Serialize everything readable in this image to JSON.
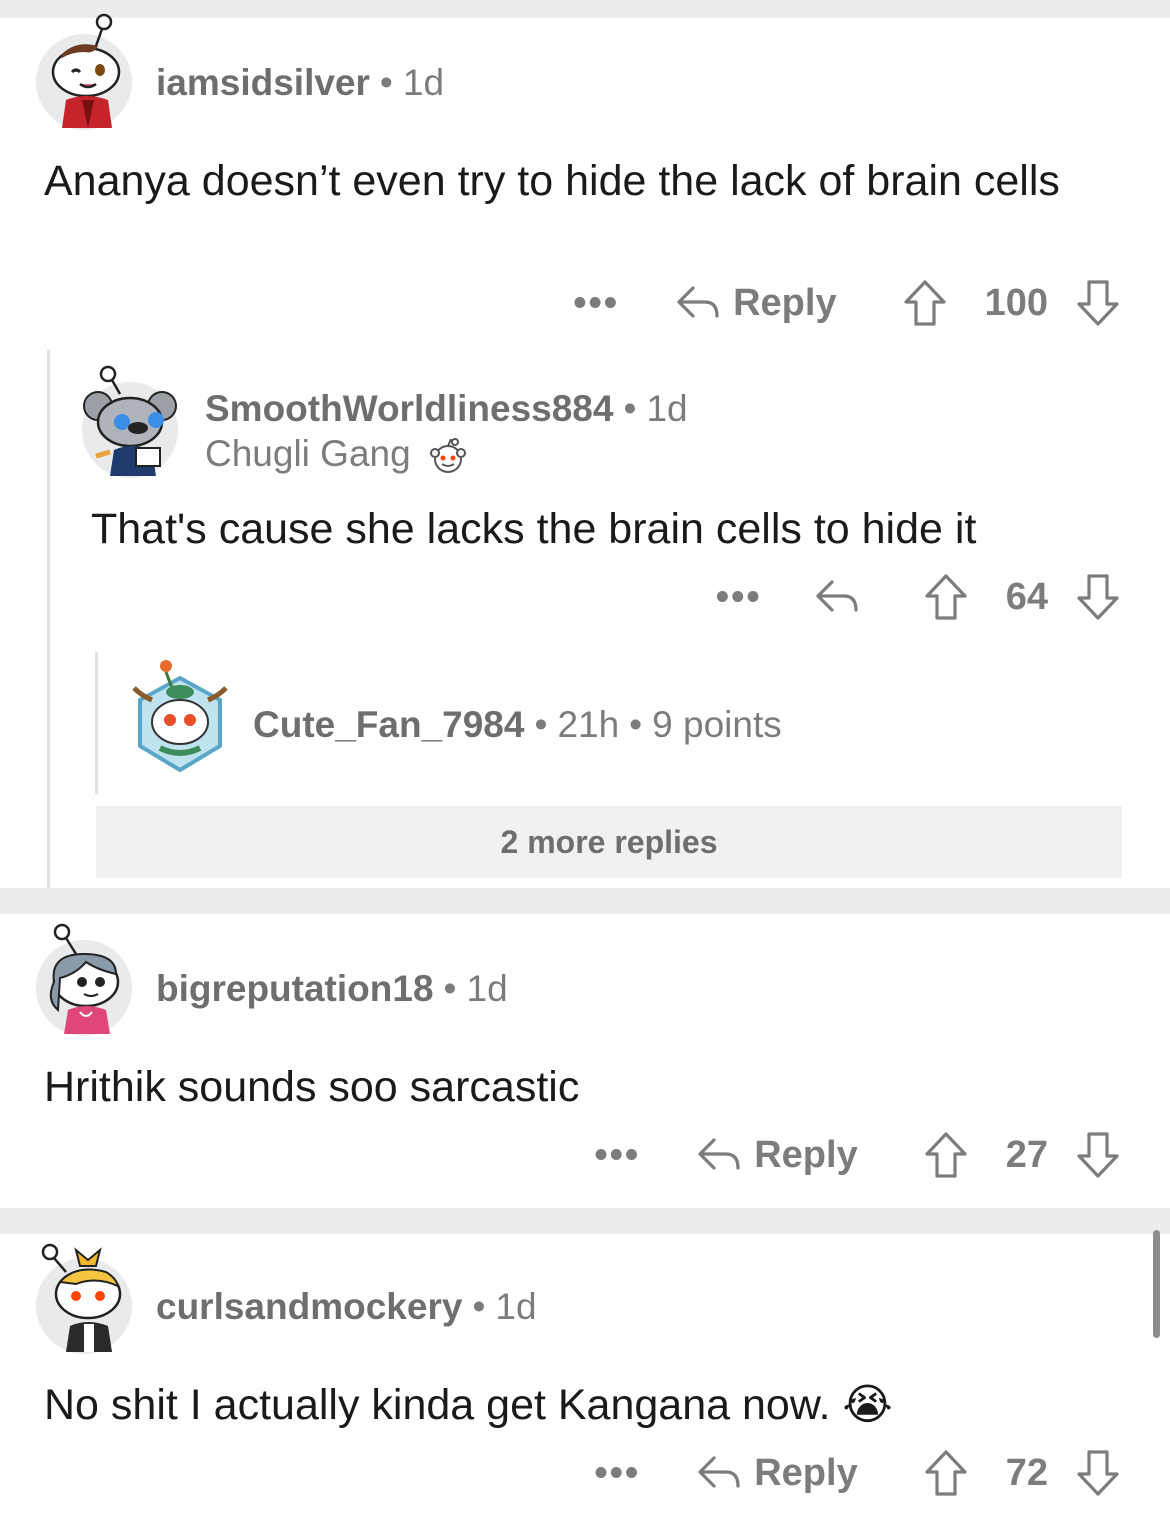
{
  "comments": [
    {
      "username": "iamsidsilver",
      "age": "1d",
      "body": "Ananya doesn’t even try to hide the lack of brain cells",
      "reply_label": "Reply",
      "score": "100"
    },
    {
      "username": "SmoothWorldliness884",
      "age": "1d",
      "flair": "Chugli Gang",
      "body": "That's cause she lacks the brain cells to hide it",
      "score": "64"
    },
    {
      "username": "Cute_Fan_7984",
      "age": "21h",
      "points": "9 points"
    },
    {
      "username": "bigreputation18",
      "age": "1d",
      "body": "Hrithik sounds soo sarcastic",
      "reply_label": "Reply",
      "score": "27"
    },
    {
      "username": "curlsandmockery",
      "age": "1d",
      "body": "No shit I actually kinda get Kangana now.",
      "emoji": "😭",
      "reply_label": "Reply",
      "score": "72"
    }
  ],
  "more_replies": "2 more replies",
  "more_symbol": "•••",
  "separator": "•",
  "colors": {
    "text": "#1a1a1b",
    "meta": "#7c7c7c",
    "band": "#ececec"
  }
}
